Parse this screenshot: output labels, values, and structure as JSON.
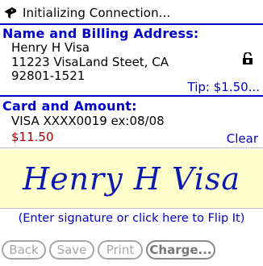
{
  "status": {
    "text": "Initializing Connection...",
    "icon": "device-icon"
  },
  "billing": {
    "heading": "Name and Billing Address:",
    "name": "Henry H Visa",
    "street": "11223 VisaLand Steet, CA",
    "zip": "92801-1521",
    "tip_label": "Tip: $1.50..."
  },
  "card": {
    "heading": "Card and Amount:",
    "info": "VISA XXXX0019 ex:08/08",
    "amount": "$11.50",
    "clear_label": "Clear"
  },
  "signature": {
    "text": "Henry H Visa"
  },
  "hint": "(Enter signature or click here to Flip It)",
  "buttons": {
    "back": "Back",
    "save": "Save",
    "print": "Print",
    "charge": "Charge..."
  },
  "colors": {
    "accent": "#0000cc",
    "amount": "#a00000",
    "signature_bg": "#ffffcc",
    "disabled": "#a6a6a6"
  }
}
